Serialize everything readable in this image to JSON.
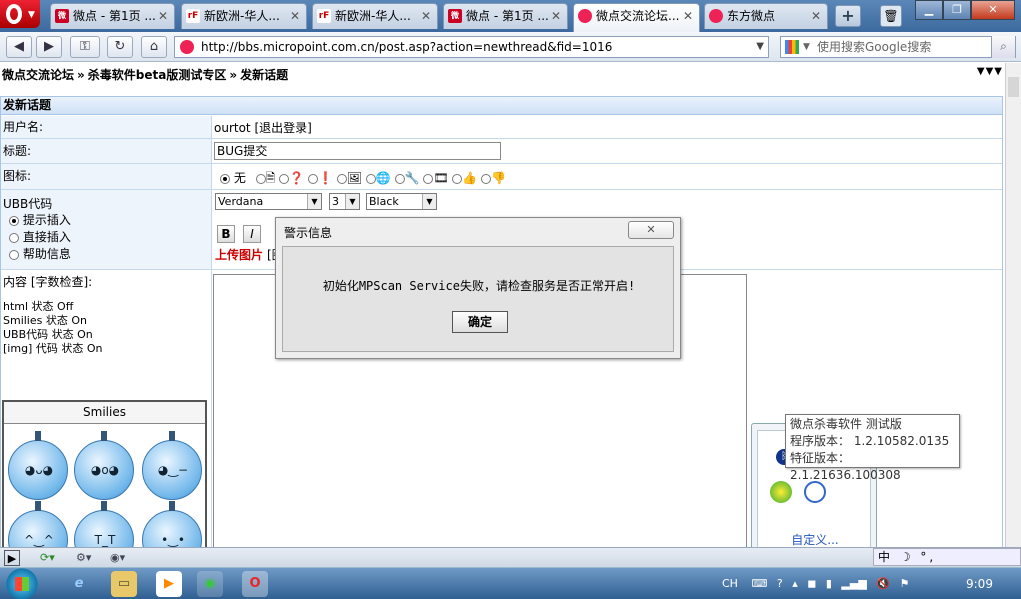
{
  "tabs": [
    {
      "label": "微点 - 第1页 ...",
      "icon": "s"
    },
    {
      "label": "新欧洲-华人...",
      "icon": "rf"
    },
    {
      "label": "新欧洲-华人...",
      "icon": "rf"
    },
    {
      "label": "微点 - 第1页 ...",
      "icon": "s"
    },
    {
      "label": "微点交流论坛...",
      "icon": "op",
      "active": true
    },
    {
      "label": "东方微点",
      "icon": "op"
    }
  ],
  "address": {
    "url": "http://bbs.micropoint.com.cn/post.asp?action=newthread&fid=1016",
    "search_placeholder": "使用搜索Google搜索"
  },
  "breadcrumb": {
    "items": [
      "微点交流论坛",
      "杀毒软件beta版测试专区",
      "发新话题"
    ],
    "sep": "»",
    "more": "▼▼▼"
  },
  "form": {
    "header": "发新话题",
    "username_label": "用户名:",
    "username_value": "ourtot [退出登录]",
    "title_label": "标题:",
    "title_value": "BUG提交",
    "icon_label": "图标:",
    "icon_none": "无",
    "ubb_label": "UBB代码",
    "ubb_options": [
      "提示插入",
      "直接插入",
      "帮助信息"
    ],
    "font_select": "Verdana",
    "size_select": "3",
    "color_select": "Black",
    "tb_bold": "B",
    "tb_italic": "I",
    "upload_label": "上传图片",
    "upload_extra": "[图",
    "content_label": "内容 [字数检查]:",
    "status_lines": [
      "html 状态 Off",
      "Smilies 状态 On",
      "UBB代码 状态 On",
      "[img] 代码 状态 On"
    ],
    "smilies_title": "Smilies"
  },
  "dialog": {
    "title": "警示信息",
    "message": "初始化MPScan Service失败，请检查服务是否正常开启!",
    "ok": "确定",
    "close": "✕"
  },
  "popup": {
    "customize": "自定义..."
  },
  "tooltip": {
    "line1": "微点杀毒软件 测试版",
    "line2": "程序版本：  1.2.10582.0135",
    "line3": "特征版本：  2.1.21636.100308"
  },
  "ime": "中 ☽ °,",
  "taskbar": {
    "lang": "CH",
    "time": "9:09"
  },
  "colors": {
    "tabbar": "#3d6a9e",
    "form_header": "#cfe2f6",
    "upload": "#cc0000",
    "link": "#2255bb"
  }
}
